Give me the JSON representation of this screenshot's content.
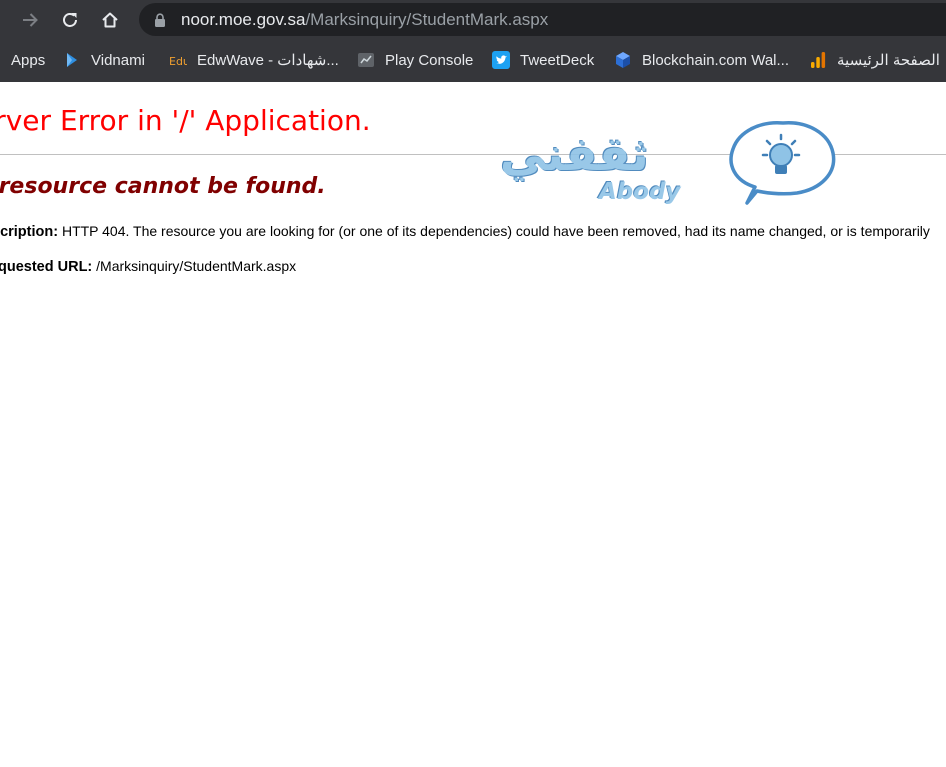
{
  "browser": {
    "url_host": "noor.moe.gov.sa",
    "url_path": "/Marksinquiry/StudentMark.aspx"
  },
  "bookmarks": [
    {
      "label": "Apps",
      "icon": "apps-grid-icon"
    },
    {
      "label": "Vidnami",
      "icon": "vidnami-icon"
    },
    {
      "label": "EdwWave - شهادات...",
      "icon": "edwwave-icon"
    },
    {
      "label": "Play Console",
      "icon": "play-console-icon"
    },
    {
      "label": "TweetDeck",
      "icon": "twitter-bird-icon"
    },
    {
      "label": "Blockchain.com Wal...",
      "icon": "blockchain-cube-icon"
    },
    {
      "label": "الصفحة الرئيسية",
      "icon": "analytics-bars-icon"
    }
  ],
  "page": {
    "title": "erver Error in '/' Application.",
    "subtitle": "e resource cannot be found.",
    "description_label": "scription:",
    "description_text": "HTTP 404. The resource you are looking for (or one of its dependencies) could have been removed, had its name changed, or is temporarily",
    "requested_url_label": "quested URL:",
    "requested_url_value": "/Marksinquiry/StudentMark.aspx"
  },
  "watermark": {
    "text": "ثقفني",
    "sub": "Abody"
  },
  "colors": {
    "chrome_bg": "#35363a",
    "omnibox_bg": "#202124",
    "error_red": "#ff0000",
    "subtitle_maroon": "#800000"
  }
}
